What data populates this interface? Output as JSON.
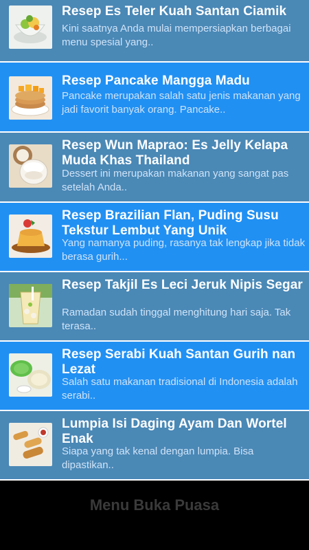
{
  "recipes": [
    {
      "title": "Resep Es Teler Kuah Santan Ciamik",
      "desc": "Kini saatnya Anda mulai mempersiapkan berbagai menu spesial yang..",
      "thumbnail_icon": "es-teler-image"
    },
    {
      "title": "Resep Pancake Mangga Madu",
      "desc": "Pancake merupakan salah satu jenis makanan yang jadi favorit banyak orang. Pancake..",
      "thumbnail_icon": "pancake-image"
    },
    {
      "title": "Resep Wun Maprao: Es Jelly Kelapa Muda Khas Thailand",
      "desc": "Dessert ini merupakan makanan yang sangat pas setelah Anda..",
      "thumbnail_icon": "coconut-jelly-image"
    },
    {
      "title": "Resep Brazilian Flan, Puding Susu Tekstur Lembut Yang Unik",
      "desc": "Yang namanya puding, rasanya tak lengkap jika tidak berasa gurih...",
      "thumbnail_icon": "flan-image"
    },
    {
      "title": "Resep Takjil Es Leci Jeruk Nipis Segar",
      "desc": "Ramadan sudah tinggal menghitung hari saja. Tak terasa..",
      "thumbnail_icon": "lychee-drink-image"
    },
    {
      "title": "Resep Serabi Kuah Santan Gurih nan Lezat",
      "desc": "Salah satu makanan tradisional di Indonesia adalah serabi..",
      "thumbnail_icon": "serabi-image"
    },
    {
      "title": "Lumpia Isi Daging Ayam Dan Wortel Enak",
      "desc": "Siapa yang tak kenal dengan lumpia. Bisa dipastikan..",
      "thumbnail_icon": "lumpia-image"
    }
  ],
  "footer": {
    "title": "Menu Buka Puasa"
  },
  "colors": {
    "row_a": "#4a88b6",
    "row_b": "#2190f3",
    "divider": "#ffffff",
    "footer_bg": "#000000"
  }
}
